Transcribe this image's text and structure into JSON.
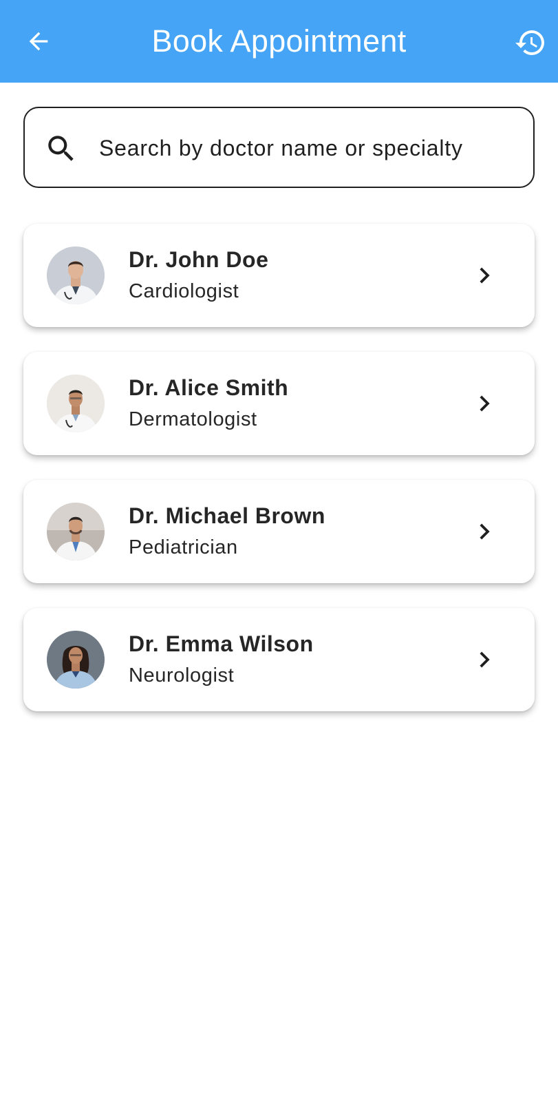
{
  "app_bar": {
    "title": "Book Appointment",
    "back_icon": "arrow-back-icon",
    "history_icon": "history-icon",
    "background_color": "#45a4f5"
  },
  "search": {
    "placeholder": "Search by doctor name or specialty",
    "value": "",
    "icon": "search-icon"
  },
  "doctors": [
    {
      "name": "Dr. John Doe",
      "specialty": "Cardiologist"
    },
    {
      "name": "Dr. Alice Smith",
      "specialty": "Dermatologist"
    },
    {
      "name": "Dr. Michael Brown",
      "specialty": "Pediatrician"
    },
    {
      "name": "Dr. Emma Wilson",
      "specialty": "Neurologist"
    }
  ]
}
